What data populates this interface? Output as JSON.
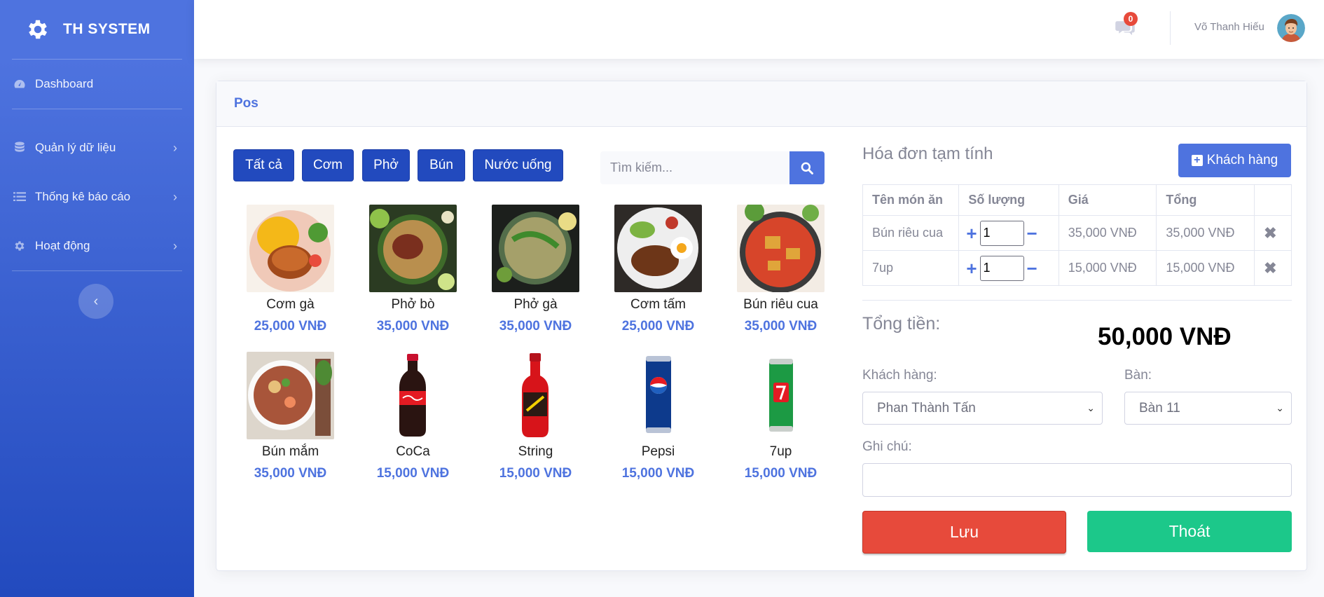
{
  "brand": {
    "name": "TH SYSTEM"
  },
  "sidebar": {
    "items": [
      {
        "label": "Dashboard",
        "icon": "tachometer-icon"
      },
      {
        "label": "Quản lý dữ liệu",
        "icon": "database-icon"
      },
      {
        "label": "Thống kê báo cáo",
        "icon": "list-icon"
      },
      {
        "label": "Hoạt động",
        "icon": "cog-icon"
      }
    ],
    "toggle_glyph": "‹"
  },
  "topbar": {
    "message_count": "0",
    "user_name": "Võ Thanh Hiếu"
  },
  "page": {
    "title": "Pos"
  },
  "categories": [
    "Tất cả",
    "Cơm",
    "Phở",
    "Bún",
    "Nước uống"
  ],
  "search": {
    "placeholder": "Tìm kiếm..."
  },
  "products": [
    {
      "name": "Cơm gà",
      "price": "25,000 VNĐ"
    },
    {
      "name": "Phở bò",
      "price": "35,000 VNĐ"
    },
    {
      "name": "Phở gà",
      "price": "35,000 VNĐ"
    },
    {
      "name": "Cơm tấm",
      "price": "25,000 VNĐ"
    },
    {
      "name": "Bún riêu cua",
      "price": "35,000 VNĐ"
    },
    {
      "name": "Bún mắm",
      "price": "35,000 VNĐ"
    },
    {
      "name": "CoCa",
      "price": "15,000 VNĐ"
    },
    {
      "name": "String",
      "price": "15,000 VNĐ"
    },
    {
      "name": "Pepsi",
      "price": "15,000 VNĐ"
    },
    {
      "name": "7up",
      "price": "15,000 VNĐ"
    }
  ],
  "bill": {
    "title": "Hóa đơn tạm tính",
    "add_customer_label": "Khách hàng",
    "columns": [
      "Tên món ăn",
      "Số lượng",
      "Giá",
      "Tổng"
    ],
    "rows": [
      {
        "name": "Bún riêu cua",
        "qty": "1",
        "price": "35,000 VNĐ",
        "total": "35,000 VNĐ"
      },
      {
        "name": "7up",
        "qty": "1",
        "price": "15,000 VNĐ",
        "total": "15,000 VNĐ"
      }
    ],
    "total_label": "Tổng tiền:",
    "total_value": "50,000 VNĐ",
    "customer_label": "Khách hàng:",
    "customer_selected": "Phan Thành Tấn",
    "table_label": "Bàn:",
    "table_selected": "Bàn 11",
    "note_label": "Ghi chú:",
    "note_value": "",
    "save_label": "Lưu",
    "exit_label": "Thoát"
  },
  "colors": {
    "primary": "#4e73df",
    "danger": "#e74a3b",
    "success": "#1cc88a",
    "category_button": "#224abe"
  }
}
